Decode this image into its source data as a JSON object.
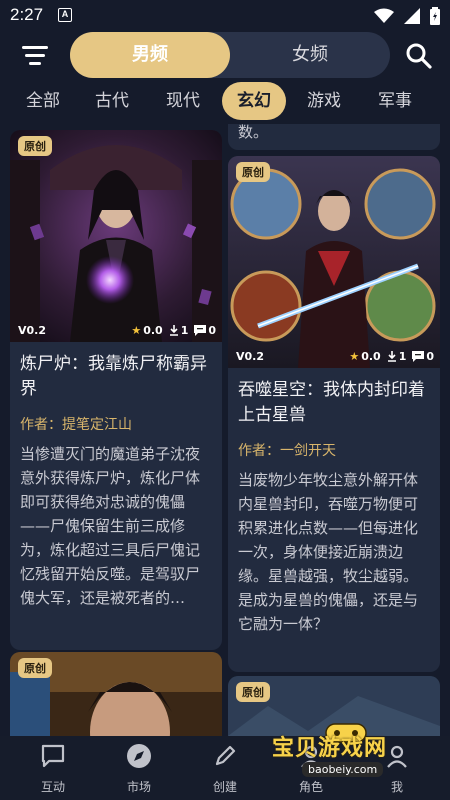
{
  "status_bar": {
    "time": "2:27",
    "notification_letter": "A"
  },
  "gender": {
    "active": "男频",
    "inactive": "女频"
  },
  "categories": [
    {
      "label": "全部"
    },
    {
      "label": "古代"
    },
    {
      "label": "现代"
    },
    {
      "label": "玄幻",
      "active": true
    },
    {
      "label": "游戏"
    },
    {
      "label": "军事"
    }
  ],
  "feed": {
    "prev_card_tail": "数。",
    "left_card": {
      "badge": "原创",
      "version": "V0.2",
      "rating": "0.0",
      "downloads": "1",
      "comments": "0",
      "title": "炼尸炉：我靠炼尸称霸异界",
      "author": "作者：提笔定江山",
      "description": "当惨遭灭门的魔道弟子沈夜意外获得炼尸炉，炼化尸体即可获得绝对忠诚的傀儡——尸傀保留生前三成修为，炼化超过三具后尸傀记忆残留开始反噬。是驾驭尸傀大军，还是被死者的…"
    },
    "right_card": {
      "badge": "原创",
      "version": "V0.2",
      "rating": "0.0",
      "downloads": "1",
      "comments": "0",
      "title": "吞噬星空：我体内封印着上古星兽",
      "author": "作者：一剑开天",
      "description": "当废物少年牧尘意外解开体内星兽封印，吞噬万物便可积累进化点数——但每进化一次，身体便接近崩溃边缘。星兽越强，牧尘越弱。是成为星兽的傀儡，还是与它融为一体？"
    },
    "left_card_2": {
      "badge": "原创"
    },
    "right_card_2": {
      "badge": "原创"
    }
  },
  "bottom_nav": [
    {
      "label": "互动",
      "icon": "chat-icon"
    },
    {
      "label": "市场",
      "icon": "compass-icon",
      "active": true
    },
    {
      "label": "创建",
      "icon": "pencil-icon"
    },
    {
      "label": "角色",
      "icon": "character-icon"
    },
    {
      "label": "我",
      "icon": "user-icon"
    }
  ],
  "watermark": {
    "text": "宝贝游戏网",
    "url": "baobeiy.com"
  },
  "colors": {
    "accent": "#e6c784",
    "background": "#151b2b",
    "card": "#222b3f",
    "author": "#d8b56b"
  }
}
